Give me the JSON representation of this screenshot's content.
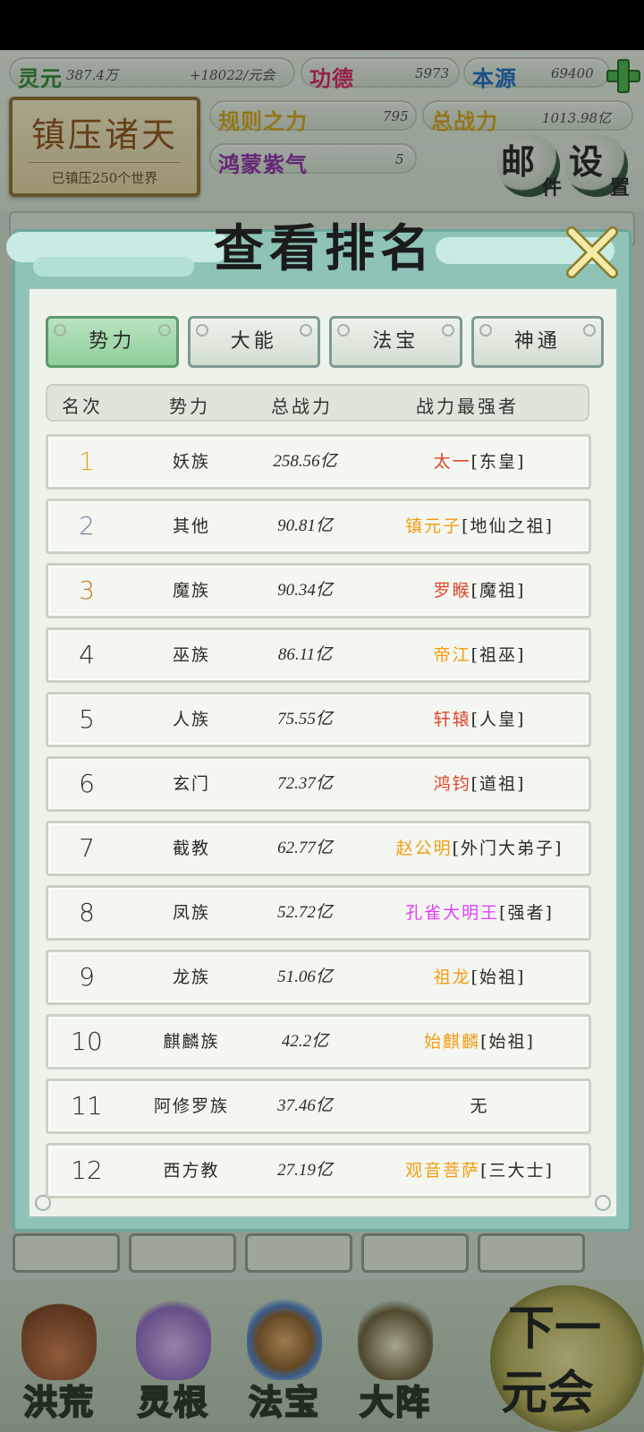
{
  "hud": {
    "lingyuan_label": "灵元",
    "lingyuan_value": "387.4万",
    "lingyuan_rate": "+18022/元会",
    "gongde_label": "功德",
    "gongde_value": "5973",
    "benyuan_label": "本源",
    "benyuan_value": "69400",
    "guize_label": "规则之力",
    "guize_value": "795",
    "zongzhanli_label": "总战力",
    "zongzhanli_value": "1013.98亿",
    "hongmeng_label": "鸿蒙紫气",
    "hongmeng_value": "5",
    "seal_title": "镇压诸天",
    "seal_sub": "已镇压250个世界",
    "mail_big": "邮",
    "mail_small": "件",
    "settings_big": "设",
    "settings_small": "置",
    "colors": {
      "lingyuan": "#2e7d32",
      "gongde": "#d81b60",
      "benyuan": "#1565c0",
      "guize": "#d4a017",
      "zongzhanli": "#d4a017",
      "hongmeng": "#8e24aa"
    }
  },
  "modal": {
    "title": "查看排名",
    "tabs": [
      {
        "label": "势力",
        "active": true
      },
      {
        "label": "大能",
        "active": false
      },
      {
        "label": "法宝",
        "active": false
      },
      {
        "label": "神通",
        "active": false
      }
    ],
    "columns": {
      "rank": "名次",
      "faction": "势力",
      "power": "总战力",
      "champion": "战力最强者"
    },
    "rows": [
      {
        "rank": "1",
        "faction": "妖族",
        "power": "258.56亿",
        "champion_name": "太一",
        "champion_title": "[东皇]",
        "name_color": "#e0452b",
        "rank_color": "#e0a21a"
      },
      {
        "rank": "2",
        "faction": "其他",
        "power": "90.81亿",
        "champion_name": "镇元子",
        "champion_title": "[地仙之祖]",
        "name_color": "#f39c12",
        "rank_color": "#6a7f9a"
      },
      {
        "rank": "3",
        "faction": "魔族",
        "power": "90.34亿",
        "champion_name": "罗睺",
        "champion_title": "[魔祖]",
        "name_color": "#e0452b",
        "rank_color": "#c8762a"
      },
      {
        "rank": "4",
        "faction": "巫族",
        "power": "86.11亿",
        "champion_name": "帝江",
        "champion_title": "[祖巫]",
        "name_color": "#f39c12",
        "rank_color": "#2b2b2b"
      },
      {
        "rank": "5",
        "faction": "人族",
        "power": "75.55亿",
        "champion_name": "轩辕",
        "champion_title": "[人皇]",
        "name_color": "#e0452b",
        "rank_color": "#2b2b2b"
      },
      {
        "rank": "6",
        "faction": "玄门",
        "power": "72.37亿",
        "champion_name": "鸿钧",
        "champion_title": "[道祖]",
        "name_color": "#e0452b",
        "rank_color": "#2b2b2b"
      },
      {
        "rank": "7",
        "faction": "截教",
        "power": "62.77亿",
        "champion_name": "赵公明",
        "champion_title": "[外门大弟子]",
        "name_color": "#f39c12",
        "rank_color": "#2b2b2b"
      },
      {
        "rank": "8",
        "faction": "凤族",
        "power": "52.72亿",
        "champion_name": "孔雀大明王",
        "champion_title": "[强者]",
        "name_color": "#e040fb",
        "rank_color": "#2b2b2b"
      },
      {
        "rank": "9",
        "faction": "龙族",
        "power": "51.06亿",
        "champion_name": "祖龙",
        "champion_title": "[始祖]",
        "name_color": "#f39c12",
        "rank_color": "#2b2b2b"
      },
      {
        "rank": "10",
        "faction": "麒麟族",
        "power": "42.2亿",
        "champion_name": "始麒麟",
        "champion_title": "[始祖]",
        "name_color": "#f39c12",
        "rank_color": "#2b2b2b"
      },
      {
        "rank": "11",
        "faction": "阿修罗族",
        "power": "37.46亿",
        "champion_name": "无",
        "champion_title": "",
        "name_color": "#2b2b2b",
        "rank_color": "#2b2b2b"
      },
      {
        "rank": "12",
        "faction": "西方教",
        "power": "27.19亿",
        "champion_name": "观音菩萨",
        "champion_title": "[三大士]",
        "name_color": "#f39c12",
        "rank_color": "#2b2b2b"
      }
    ]
  },
  "bottom_nav": {
    "items": [
      {
        "label": "洪荒",
        "icon": "mountain-icon"
      },
      {
        "label": "灵根",
        "icon": "lotus-icon"
      },
      {
        "label": "法宝",
        "icon": "treasure-icon"
      },
      {
        "label": "大阵",
        "icon": "taiji-icon"
      }
    ],
    "next_top": "下一",
    "next_bottom": "元会"
  }
}
